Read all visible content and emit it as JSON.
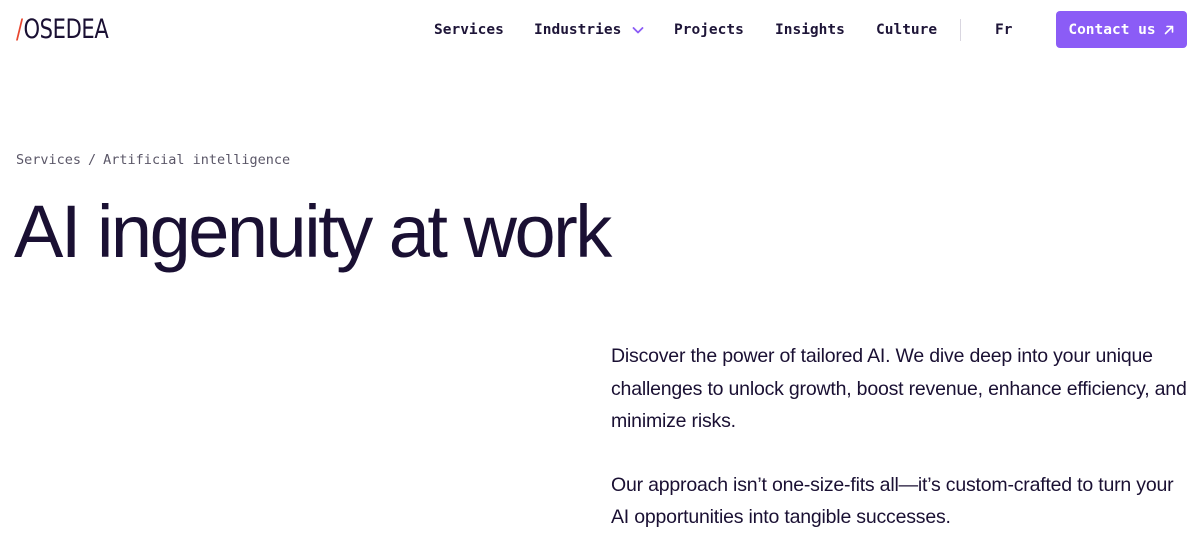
{
  "header": {
    "logo": {
      "slash": "/",
      "text": "OSEDEA"
    },
    "nav": {
      "services": "Services",
      "industries": "Industries",
      "projects": "Projects",
      "insights": "Insights",
      "culture": "Culture",
      "language": "Fr"
    },
    "contact_label": "Contact us",
    "accent_color": "#8b5cf6",
    "logo_slash_color": "#e8462f"
  },
  "breadcrumb": {
    "items": [
      "Services",
      "Artificial intelligence"
    ],
    "separator": "/"
  },
  "hero": {
    "title": "AI ingenuity at work",
    "paragraphs": [
      "Discover the power of tailored AI. We dive deep into your unique challenges to unlock growth, boost revenue, enhance efficiency, and minimize risks.",
      "Our approach isn’t one-size-fits all—it’s custom-crafted to turn your AI opportunities into tangible successes."
    ]
  },
  "icons": {
    "industries_dropdown": "chevron-down-icon",
    "contact": "arrow-up-right-icon"
  }
}
